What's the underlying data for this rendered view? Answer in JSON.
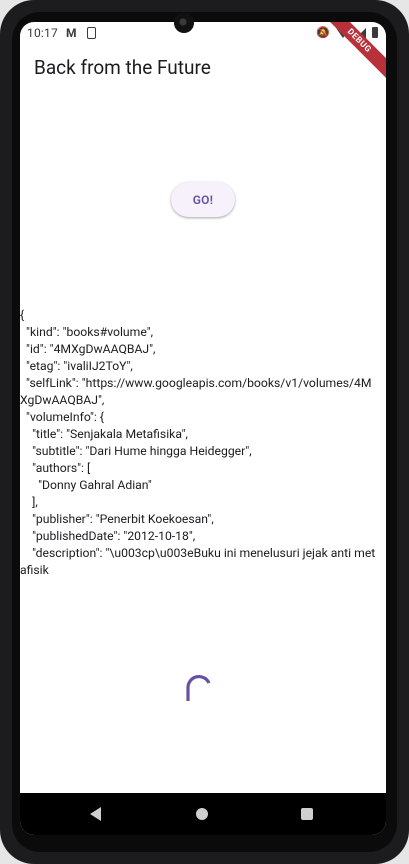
{
  "status_bar": {
    "time": "10:17",
    "icons": [
      "mail-icon",
      "sim-icon",
      "bell-off-icon",
      "wifi-icon",
      "signal-icon",
      "battery-icon"
    ]
  },
  "debug_banner": "DEBUG",
  "app_bar": {
    "title": "Back from the Future"
  },
  "go_button": {
    "label": "GO!"
  },
  "json_output": "{\n  \"kind\": \"books#volume\",\n  \"id\": \"4MXgDwAAQBAJ\",\n  \"etag\": \"ivaliIJ2ToY\",\n  \"selfLink\": \"https://www.googleapis.com/books/v1/volumes/4MXgDwAAQBAJ\",\n  \"volumeInfo\": {\n    \"title\": \"Senjakala Metafisika\",\n    \"subtitle\": \"Dari Hume hingga Heidegger\",\n    \"authors\": [\n      \"Donny Gahral Adian\"\n    ],\n    \"publisher\": \"Penerbit Koekoesan\",\n    \"publishedDate\": \"2012-10-18\",\n    \"description\": \"\\u003cp\\u003eBuku ini menelusuri jejak anti metafisik",
  "nav_bar": {
    "icons": [
      "back-icon",
      "home-icon",
      "recents-icon"
    ]
  },
  "colors": {
    "accent": "#6750a4",
    "button_bg": "#f6f1fb",
    "debug_banner": "#b7313a",
    "nav_bar": "#000000"
  }
}
